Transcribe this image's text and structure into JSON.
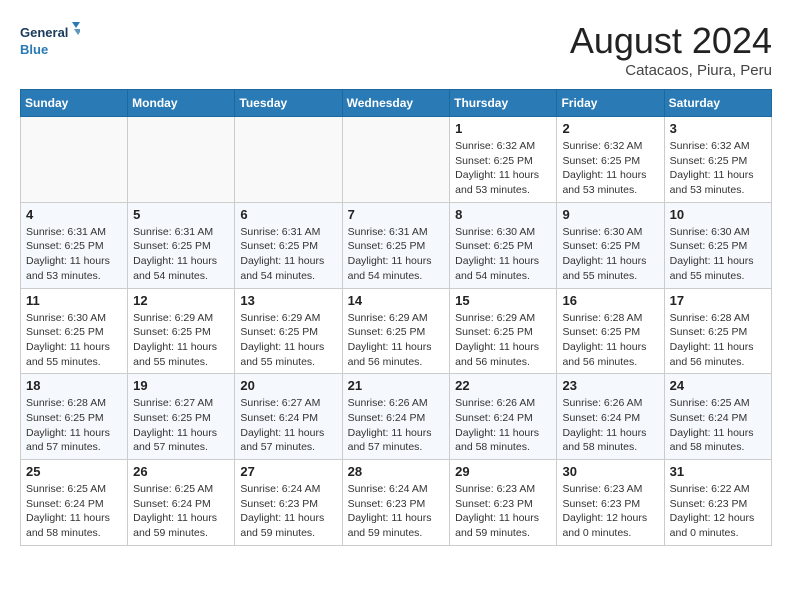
{
  "header": {
    "logo_line1": "General",
    "logo_line2": "Blue",
    "month_year": "August 2024",
    "location": "Catacaos, Piura, Peru"
  },
  "weekdays": [
    "Sunday",
    "Monday",
    "Tuesday",
    "Wednesday",
    "Thursday",
    "Friday",
    "Saturday"
  ],
  "weeks": [
    [
      {
        "day": "",
        "info": ""
      },
      {
        "day": "",
        "info": ""
      },
      {
        "day": "",
        "info": ""
      },
      {
        "day": "",
        "info": ""
      },
      {
        "day": "1",
        "info": "Sunrise: 6:32 AM\nSunset: 6:25 PM\nDaylight: 11 hours\nand 53 minutes."
      },
      {
        "day": "2",
        "info": "Sunrise: 6:32 AM\nSunset: 6:25 PM\nDaylight: 11 hours\nand 53 minutes."
      },
      {
        "day": "3",
        "info": "Sunrise: 6:32 AM\nSunset: 6:25 PM\nDaylight: 11 hours\nand 53 minutes."
      }
    ],
    [
      {
        "day": "4",
        "info": "Sunrise: 6:31 AM\nSunset: 6:25 PM\nDaylight: 11 hours\nand 53 minutes."
      },
      {
        "day": "5",
        "info": "Sunrise: 6:31 AM\nSunset: 6:25 PM\nDaylight: 11 hours\nand 54 minutes."
      },
      {
        "day": "6",
        "info": "Sunrise: 6:31 AM\nSunset: 6:25 PM\nDaylight: 11 hours\nand 54 minutes."
      },
      {
        "day": "7",
        "info": "Sunrise: 6:31 AM\nSunset: 6:25 PM\nDaylight: 11 hours\nand 54 minutes."
      },
      {
        "day": "8",
        "info": "Sunrise: 6:30 AM\nSunset: 6:25 PM\nDaylight: 11 hours\nand 54 minutes."
      },
      {
        "day": "9",
        "info": "Sunrise: 6:30 AM\nSunset: 6:25 PM\nDaylight: 11 hours\nand 55 minutes."
      },
      {
        "day": "10",
        "info": "Sunrise: 6:30 AM\nSunset: 6:25 PM\nDaylight: 11 hours\nand 55 minutes."
      }
    ],
    [
      {
        "day": "11",
        "info": "Sunrise: 6:30 AM\nSunset: 6:25 PM\nDaylight: 11 hours\nand 55 minutes."
      },
      {
        "day": "12",
        "info": "Sunrise: 6:29 AM\nSunset: 6:25 PM\nDaylight: 11 hours\nand 55 minutes."
      },
      {
        "day": "13",
        "info": "Sunrise: 6:29 AM\nSunset: 6:25 PM\nDaylight: 11 hours\nand 55 minutes."
      },
      {
        "day": "14",
        "info": "Sunrise: 6:29 AM\nSunset: 6:25 PM\nDaylight: 11 hours\nand 56 minutes."
      },
      {
        "day": "15",
        "info": "Sunrise: 6:29 AM\nSunset: 6:25 PM\nDaylight: 11 hours\nand 56 minutes."
      },
      {
        "day": "16",
        "info": "Sunrise: 6:28 AM\nSunset: 6:25 PM\nDaylight: 11 hours\nand 56 minutes."
      },
      {
        "day": "17",
        "info": "Sunrise: 6:28 AM\nSunset: 6:25 PM\nDaylight: 11 hours\nand 56 minutes."
      }
    ],
    [
      {
        "day": "18",
        "info": "Sunrise: 6:28 AM\nSunset: 6:25 PM\nDaylight: 11 hours\nand 57 minutes."
      },
      {
        "day": "19",
        "info": "Sunrise: 6:27 AM\nSunset: 6:25 PM\nDaylight: 11 hours\nand 57 minutes."
      },
      {
        "day": "20",
        "info": "Sunrise: 6:27 AM\nSunset: 6:24 PM\nDaylight: 11 hours\nand 57 minutes."
      },
      {
        "day": "21",
        "info": "Sunrise: 6:26 AM\nSunset: 6:24 PM\nDaylight: 11 hours\nand 57 minutes."
      },
      {
        "day": "22",
        "info": "Sunrise: 6:26 AM\nSunset: 6:24 PM\nDaylight: 11 hours\nand 58 minutes."
      },
      {
        "day": "23",
        "info": "Sunrise: 6:26 AM\nSunset: 6:24 PM\nDaylight: 11 hours\nand 58 minutes."
      },
      {
        "day": "24",
        "info": "Sunrise: 6:25 AM\nSunset: 6:24 PM\nDaylight: 11 hours\nand 58 minutes."
      }
    ],
    [
      {
        "day": "25",
        "info": "Sunrise: 6:25 AM\nSunset: 6:24 PM\nDaylight: 11 hours\nand 58 minutes."
      },
      {
        "day": "26",
        "info": "Sunrise: 6:25 AM\nSunset: 6:24 PM\nDaylight: 11 hours\nand 59 minutes."
      },
      {
        "day": "27",
        "info": "Sunrise: 6:24 AM\nSunset: 6:23 PM\nDaylight: 11 hours\nand 59 minutes."
      },
      {
        "day": "28",
        "info": "Sunrise: 6:24 AM\nSunset: 6:23 PM\nDaylight: 11 hours\nand 59 minutes."
      },
      {
        "day": "29",
        "info": "Sunrise: 6:23 AM\nSunset: 6:23 PM\nDaylight: 11 hours\nand 59 minutes."
      },
      {
        "day": "30",
        "info": "Sunrise: 6:23 AM\nSunset: 6:23 PM\nDaylight: 12 hours\nand 0 minutes."
      },
      {
        "day": "31",
        "info": "Sunrise: 6:22 AM\nSunset: 6:23 PM\nDaylight: 12 hours\nand 0 minutes."
      }
    ]
  ]
}
